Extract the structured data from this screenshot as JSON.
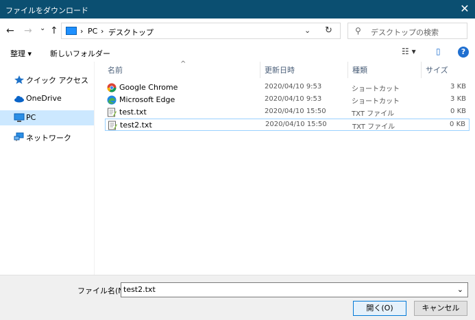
{
  "window": {
    "title": "ファイルをダウンロード",
    "close_glyph": "✕"
  },
  "nav": {
    "back_glyph": "←",
    "forward_glyph": "→",
    "recent_glyph": "⌄",
    "up_glyph": "↑",
    "breadcrumb": [
      "PC",
      "デスクトップ"
    ],
    "separator": "›",
    "refresh_glyph": "↻",
    "search_placeholder": "デスクトップの検索"
  },
  "toolbar": {
    "organize": "整理 ▾",
    "new_folder": "新しいフォルダー",
    "view_glyph": "☷ ▾",
    "pane_glyph": "▯",
    "help_glyph": "?"
  },
  "sidebar": {
    "items": [
      {
        "label": "クイック アクセス",
        "icon": "star-icon"
      },
      {
        "label": "OneDrive",
        "icon": "cloud-icon"
      },
      {
        "label": "PC",
        "icon": "monitor-icon",
        "selected": true
      },
      {
        "label": "ネットワーク",
        "icon": "network-icon"
      }
    ]
  },
  "columns": {
    "name": "名前",
    "modified": "更新日時",
    "type": "種類",
    "size": "サイズ",
    "sort_glyph": "^"
  },
  "files": [
    {
      "name": "Google Chrome",
      "modified": "2020/04/10 9:53",
      "type": "ショートカット",
      "size": "3 KB",
      "icon": "chrome-icon"
    },
    {
      "name": "Microsoft Edge",
      "modified": "2020/04/10 9:53",
      "type": "ショートカット",
      "size": "3 KB",
      "icon": "edge-icon"
    },
    {
      "name": "test.txt",
      "modified": "2020/04/10 15:50",
      "type": "TXT ファイル",
      "size": "0 KB",
      "icon": "text-file-icon"
    },
    {
      "name": "test2.txt",
      "modified": "2020/04/10 15:50",
      "type": "TXT ファイル",
      "size": "0 KB",
      "icon": "text-file-icon",
      "selected": true
    }
  ],
  "footer": {
    "filename_label": "ファイル名(N):",
    "filename_value": "test2.txt",
    "dropdown_glyph": "⌄",
    "open_button": "開く(O)",
    "cancel_button": "キャンセル"
  },
  "colors": {
    "titlebar": "#0b4f71",
    "selection": "#cce8ff",
    "accent": "#0078d7"
  }
}
